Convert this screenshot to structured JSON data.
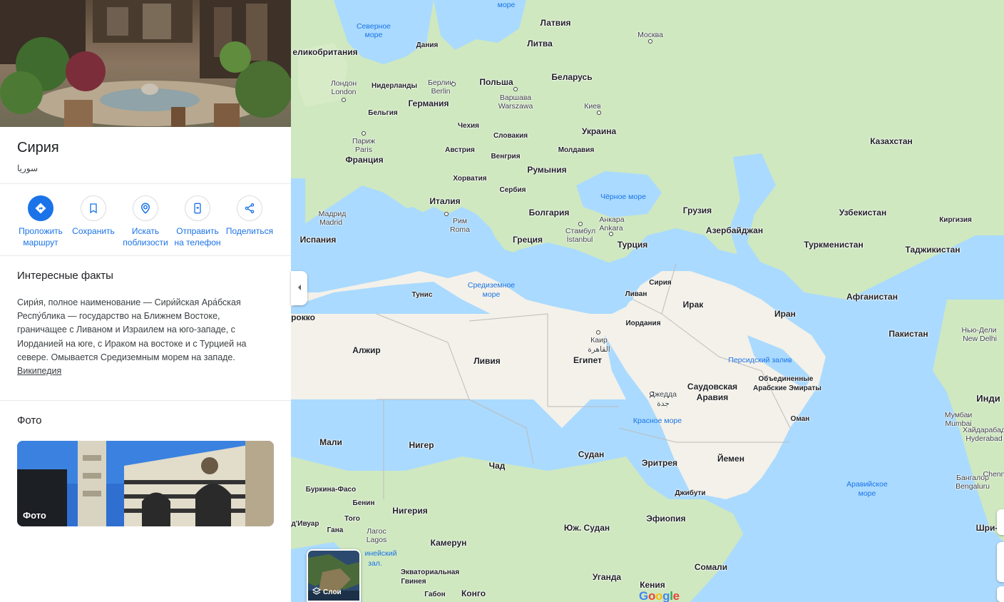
{
  "place": {
    "title": "Сирия",
    "subtitle": "سوريا"
  },
  "actions": [
    {
      "line1": "Проложить",
      "line2": "маршрут",
      "icon": "directions-icon"
    },
    {
      "line1": "Сохранить",
      "line2": "",
      "icon": "bookmark-icon"
    },
    {
      "line1": "Искать",
      "line2": "поблизости",
      "icon": "nearby-icon"
    },
    {
      "line1": "Отправить",
      "line2": "на телефон",
      "icon": "send-to-phone-icon"
    },
    {
      "line1": "Поделиться",
      "line2": "",
      "icon": "share-icon"
    }
  ],
  "facts": {
    "heading": "Интересные факты",
    "text": "Сири́я, полное наименование — Сири́йская Ара́бская Респу́блика — государство на Ближнем Востоке, граничащее с Ливаном и Израилем на юго-западе, с Иорданией на юге, с Ираком на востоке и с Турцией на севере. Омывается Средиземным морем на западе.",
    "link": "Википедия"
  },
  "photos": {
    "heading": "Фото",
    "card_label": "Фото"
  },
  "map": {
    "layers_label": "Слои",
    "logo": "Google",
    "countries": {
      "latvia": "Латвия",
      "lithuania": "Литва",
      "belarus": "Беларусь",
      "poland": "Польша",
      "germany": "Германия",
      "netherlands": "Нидерланды",
      "belgium": "Бельгия",
      "denmark": "Дания",
      "uk": "еликобритания",
      "france": "Франция",
      "spain": "Испания",
      "italy": "Италия",
      "czech": "Чехия",
      "slovakia": "Словакия",
      "austria": "Австрия",
      "hungary": "Венгрия",
      "moldova": "Молдавия",
      "ukraine": "Украина",
      "romania": "Румыния",
      "croatia": "Хорватия",
      "serbia": "Сербия",
      "bulgaria": "Болгария",
      "greece": "Греция",
      "turkey": "Турция",
      "georgia": "Грузия",
      "azerbaijan": "Азербайджан",
      "kazakhstan": "Казахстан",
      "uzbekistan": "Узбекистан",
      "kyrgyzstan": "Киргизия",
      "turkmenistan": "Туркменистан",
      "tajikistan": "Таджикистан",
      "afghanistan": "Афганистан",
      "pakistan": "Пакистан",
      "iran": "Иран",
      "iraq": "Ирак",
      "syria": "Сирия",
      "lebanon": "Ливан",
      "jordan": "Иордания",
      "saudi_line1": "Саудовская",
      "saudi_line2": "Аравия",
      "uae_line1": "Объединенные",
      "uae_line2": "Арабские Эмираты",
      "oman": "Оман",
      "yemen": "Йемен",
      "egypt": "Египет",
      "libya": "Ливия",
      "algeria": "Алжир",
      "tunisia": "Тунис",
      "morocco": "рокко",
      "mali": "Мали",
      "niger": "Нигер",
      "chad": "Чад",
      "sudan": "Судан",
      "eritrea": "Эритрея",
      "djibouti": "Джибути",
      "ethiopia": "Эфиопия",
      "south_sudan": "Юж. Судан",
      "nigeria": "Нигерия",
      "burkina": "Буркина-Фасо",
      "benin": "Бенин",
      "togo": "Того",
      "ghana": "Гана",
      "ivory": "д'Ивуар",
      "cameroon": "Камерун",
      "eq_guinea_line1": "Экваториальная",
      "eq_guinea_line2": "Гвинея",
      "gabon": "Габон",
      "congo": "Конго",
      "uganda": "Уганда",
      "kenya": "Кения",
      "somalia": "Сомали",
      "india": "Инди"
    },
    "cities": {
      "moscow": "Москва",
      "london1": "Лондон",
      "london2": "London",
      "berlin1": "Берлин",
      "berlin2": "Berlin",
      "warsaw1": "Варшава",
      "warsaw2": "Warszawa",
      "kyiv": "Киев",
      "paris1": "Париж",
      "paris2": "Paris",
      "madrid1": "Мадрид",
      "madrid2": "Madrid",
      "rome1": "Рим",
      "rome2": "Roma",
      "istanbul1": "Стамбул",
      "istanbul2": "İstanbul",
      "ankara1": "Анкара",
      "ankara2": "Ankara",
      "cairo1": "Каир",
      "cairo2": "القاهرة",
      "jeddah1": "Джедда",
      "jeddah2": "جدة",
      "delhi1": "Нью-Дели",
      "delhi2": "New Delhi",
      "mumbai1": "Мумбаи",
      "mumbai2": "Mumbai",
      "hyderabad1": "Хайдарабад",
      "hyderabad2": "Hyderabad",
      "bangalore1": "Бангалор",
      "bangalore2": "Bengaluru",
      "chennai": "Chenn",
      "lagos1": "Лагос",
      "lagos2": "Lagos",
      "sri": "Шри-"
    },
    "waters": {
      "north_sea_1": "Северное",
      "north_sea_2": "море",
      "baltic": "море",
      "black_sea": "Чёрное море",
      "med_1": "Средиземное",
      "med_2": "море",
      "persian_gulf": "Персидский залив",
      "red_sea": "Красное море",
      "arabian_1": "Аравийское",
      "arabian_2": "море",
      "guinea_1": "инейский",
      "guinea_2": "зал."
    }
  }
}
